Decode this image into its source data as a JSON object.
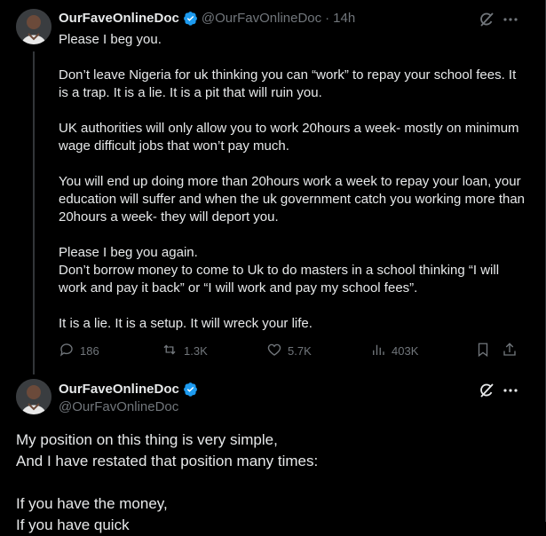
{
  "tweet1": {
    "name": "OurFaveOnlineDoc",
    "handle": "@OurFavOnlineDoc",
    "separator": "·",
    "time": "14h",
    "paragraphs": [
      "Please I beg you.",
      "Don’t leave Nigeria for uk thinking you can “work” to repay your school fees. It is a trap. It is a lie. It is a pit that will ruin you.",
      "UK authorities will only allow you to work 20hours a week- mostly on minimum wage difficult jobs that won’t pay much.",
      "You will end up doing more than 20hours work a week to repay your loan, your education will suffer and when the uk government catch you working more than 20hours a week- they will deport you.",
      "Please I beg you again.",
      "Don’t borrow money to come to Uk to do masters in a school thinking “I will work and pay it back” or “I will work and pay my school fees”.",
      "It is a lie. It is a setup. It will wreck your life."
    ],
    "stats": {
      "replies": "186",
      "reposts": "1.3K",
      "likes": "5.7K",
      "views": "403K"
    }
  },
  "tweet2": {
    "name": "OurFaveOnlineDoc",
    "handle": "@OurFavOnlineDoc",
    "paragraphs": [
      "My position on this thing is very simple,",
      "And I have restated that position many times:",
      "If you have the money,",
      "If you have quick"
    ]
  },
  "colors": {
    "background": "#000000",
    "text": "#e7e9ea",
    "muted": "#71767b",
    "verified": "#1d9bf0"
  },
  "icons": [
    "verified-badge-icon",
    "grok-icon",
    "more-icon",
    "reply-icon",
    "repost-icon",
    "like-icon",
    "views-icon",
    "bookmark-icon",
    "share-icon"
  ]
}
